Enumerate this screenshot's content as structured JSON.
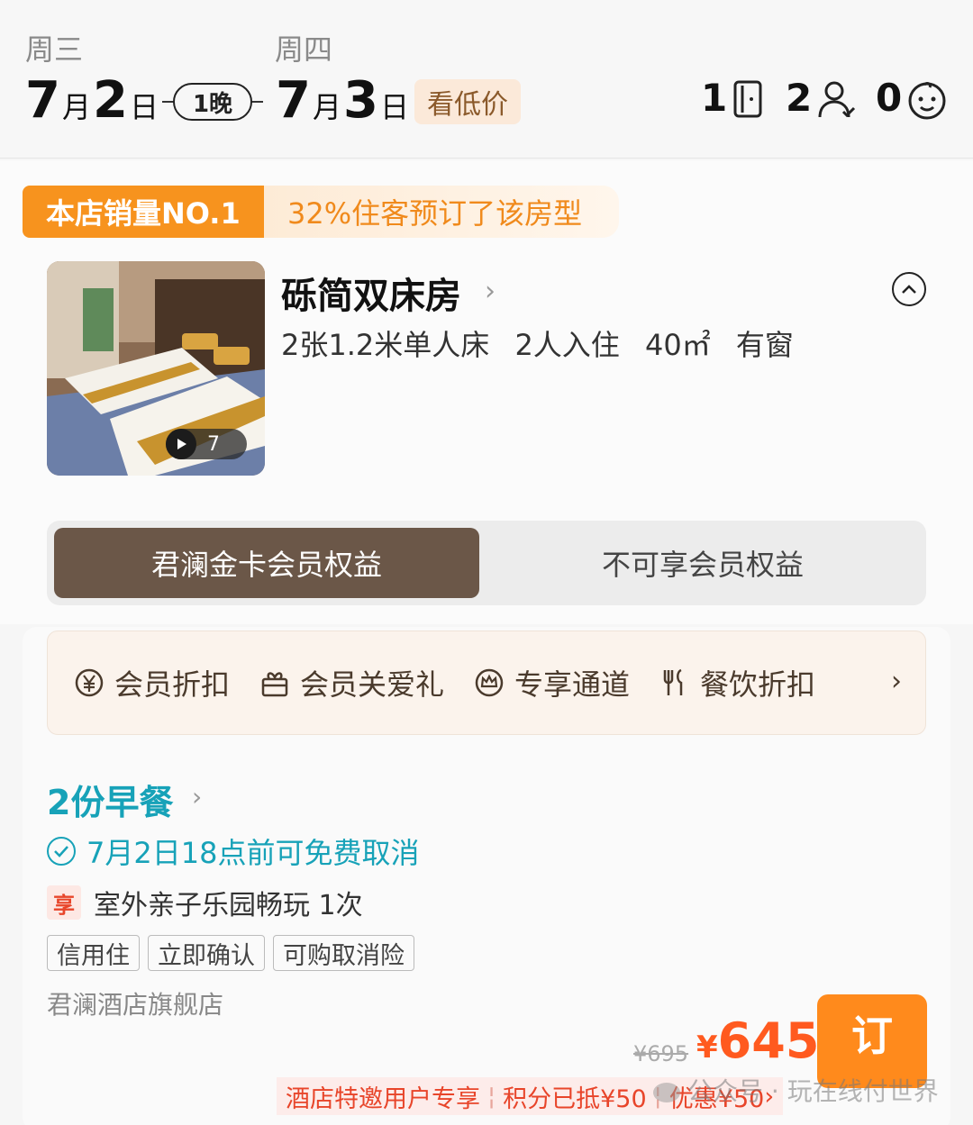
{
  "header": {
    "checkin": {
      "weekday": "周三",
      "month": "7",
      "month_unit": "月",
      "day": "2",
      "day_unit": "日"
    },
    "checkout": {
      "weekday": "周四",
      "month": "7",
      "month_unit": "月",
      "day": "3",
      "day_unit": "日"
    },
    "nights": "1晚",
    "low_price_label": "看低价",
    "occupancy": {
      "rooms": "1",
      "adults": "2",
      "children": "0"
    }
  },
  "room": {
    "badge_primary": "本店销量NO.1",
    "badge_secondary": "32%住客预订了该房型",
    "name": "砾简双床房",
    "facts": [
      "2张1.2米单人床",
      "2人入住",
      "40㎡",
      "有窗"
    ],
    "photo_count": "7",
    "member_toggle": {
      "active": "君澜金卡会员权益",
      "inactive": "不可享会员权益"
    }
  },
  "rate_plan": {
    "benefits": [
      {
        "icon": "yen-circle-icon",
        "label": "会员折扣"
      },
      {
        "icon": "gift-icon",
        "label": "会员关爱礼"
      },
      {
        "icon": "crown-icon",
        "label": "专享通道"
      },
      {
        "icon": "fork-knife-icon",
        "label": "餐饮折扣"
      }
    ],
    "breakfast": "2份早餐",
    "cancellation": "7月2日18点前可免费取消",
    "perk_tag": "享",
    "perk": "室外亲子乐园畅玩 1次",
    "tags": [
      "信用住",
      "立即确认",
      "可购取消险"
    ],
    "store": "君澜酒店旗舰店",
    "original_price": "¥695",
    "currency": "¥",
    "price": "645",
    "book_label": "订",
    "promo": {
      "invite": "酒店特邀用户专享",
      "points": "积分已抵¥50",
      "discount": "优惠¥50"
    },
    "watermark": "公众号 · 玩在线付世界"
  },
  "colors": {
    "accent_orange": "#ff8a1c",
    "price_red": "#ff5a1f",
    "teal": "#17a2b8",
    "member_brown": "#6b5748"
  }
}
